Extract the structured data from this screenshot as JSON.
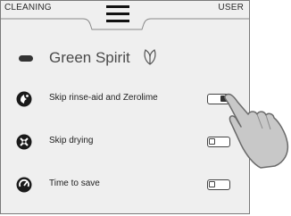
{
  "top_bar": {
    "left_tab": "CLEANING",
    "right_tab": "USER",
    "menu_icon": "hamburger-menu-icon"
  },
  "header": {
    "title": "Green Spirit",
    "left_icon": "pill-indicator-icon",
    "title_icon": "leaf-icon"
  },
  "options": [
    {
      "label": "Skip rinse-aid  and Zerolime",
      "icon": "rinse-aid-icon",
      "enabled": true
    },
    {
      "label": "Skip drying",
      "icon": "no-drying-icon",
      "enabled": false
    },
    {
      "label": "Time to save",
      "icon": "time-save-icon",
      "enabled": false
    }
  ],
  "colors": {
    "background": "#efefef",
    "text": "#222222",
    "icon": "#1a1a1a"
  }
}
